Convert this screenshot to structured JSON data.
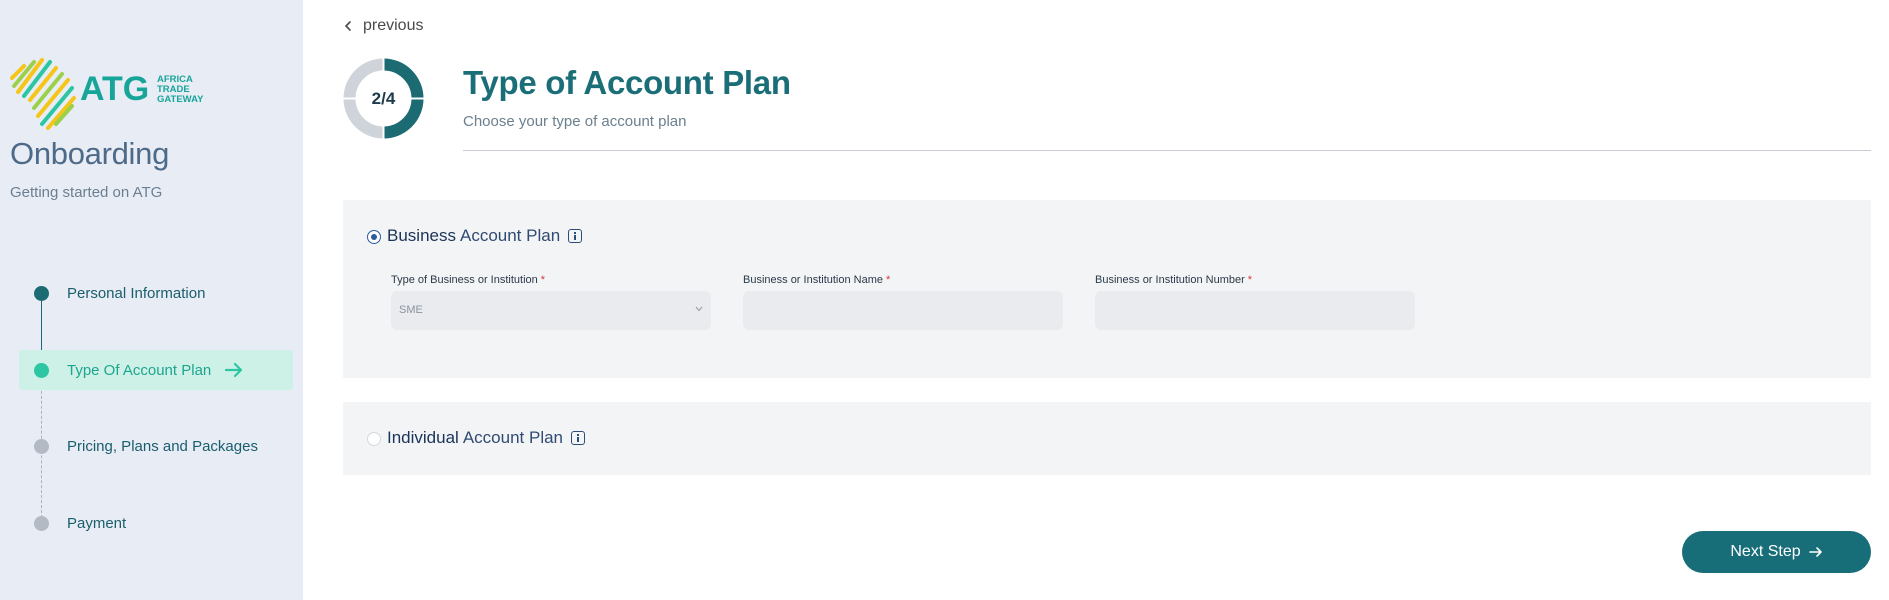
{
  "sidebar": {
    "logo": {
      "mark": "ATG",
      "line1": "AFRICA",
      "line2": "TRADE",
      "line3": "GATEWAY"
    },
    "title": "Onboarding",
    "subtitle": "Getting started on ATG",
    "steps": [
      {
        "label": "Personal Information",
        "state": "done"
      },
      {
        "label": "Type Of Account Plan",
        "state": "active"
      },
      {
        "label": "Pricing, Plans and Packages",
        "state": "pending"
      },
      {
        "label": "Payment",
        "state": "pending"
      }
    ]
  },
  "header": {
    "previous_label": "previous",
    "progress_text": "2/4",
    "progress_fraction": 0.5,
    "title": "Type of Account Plan",
    "subtitle": "Choose your type of account plan"
  },
  "business_plan": {
    "selected": true,
    "bold": "Business",
    "rest": "Account Plan",
    "fields": [
      {
        "label": "Type of Business or Institution",
        "value": "SME",
        "type": "select"
      },
      {
        "label": "Business or Institution Name",
        "value": "",
        "type": "text"
      },
      {
        "label": "Business or Institution Number",
        "value": "",
        "type": "text"
      }
    ],
    "required_mark": "*"
  },
  "individual_plan": {
    "selected": false,
    "bold": "Individual",
    "rest": "Account Plan"
  },
  "footer": {
    "next_label": "Next Step"
  },
  "colors": {
    "primary": "#186e78",
    "accent": "#2cc6a3",
    "sidebar_bg": "#e8ecf5",
    "panel_bg": "#f3f4f6"
  }
}
